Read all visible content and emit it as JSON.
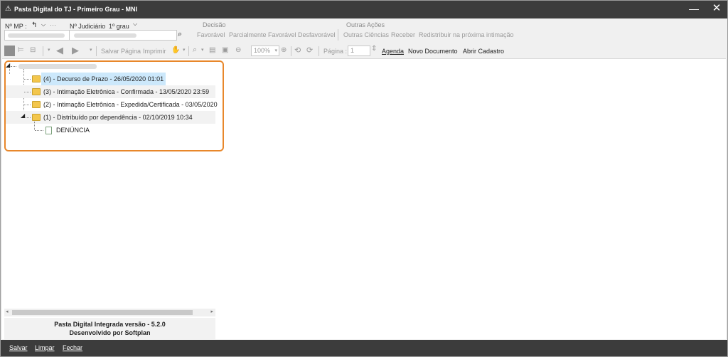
{
  "window": {
    "title": "Pasta Digital do TJ - Primeiro Grau - MNI",
    "minimize_symbol": "—",
    "close_symbol": "✕"
  },
  "header": {
    "mp_label": "Nº MP :",
    "ellipsis": "···",
    "judiciario_label": "Nº Judiciário",
    "grau_label": "1º grau",
    "decisao_title": "Decisão",
    "decisao_actions": [
      "Favorável",
      "Parcialmente Favorável",
      "Desfavorável"
    ],
    "outras_title": "Outras Ações",
    "outras_actions": [
      "Outras Ciências",
      "Receber",
      "Redistribuir na próxima intimação"
    ]
  },
  "toolbar": {
    "salvar_pagina": "Salvar Página",
    "imprimir": "Imprimir",
    "zoom": "100%",
    "pagina_label": "Página :",
    "pagina_value": "1",
    "agenda": "Agenda",
    "novo_documento": "Novo Documento",
    "abrir_cadastro": "Abrir Cadastro"
  },
  "tree": {
    "items": [
      {
        "label": "(4) - Decurso de Prazo - 26/05/2020 01:01",
        "selected": true
      },
      {
        "label": "(3) - Intimação Eletrônica - Confirmada - 13/05/2020 23:59"
      },
      {
        "label": "(2) - Intimação Eletrônica - Expedida/Certificada - 03/05/2020"
      },
      {
        "label": "(1) - Distribuído por dependência - 02/10/2019 10:34"
      }
    ],
    "child": "DENÚNCIA"
  },
  "info": {
    "line1": "Pasta Digital Integrada versão - 5.2.0",
    "line2": "Desenvolvido por Softplan"
  },
  "bottom": {
    "salvar": "Salvar",
    "limpar": "Limpar",
    "fechar": "Fechar"
  },
  "colors": {
    "titlebar": "#3c3c3c",
    "highlight_border": "#e8872b",
    "selection": "#cce8fb"
  }
}
